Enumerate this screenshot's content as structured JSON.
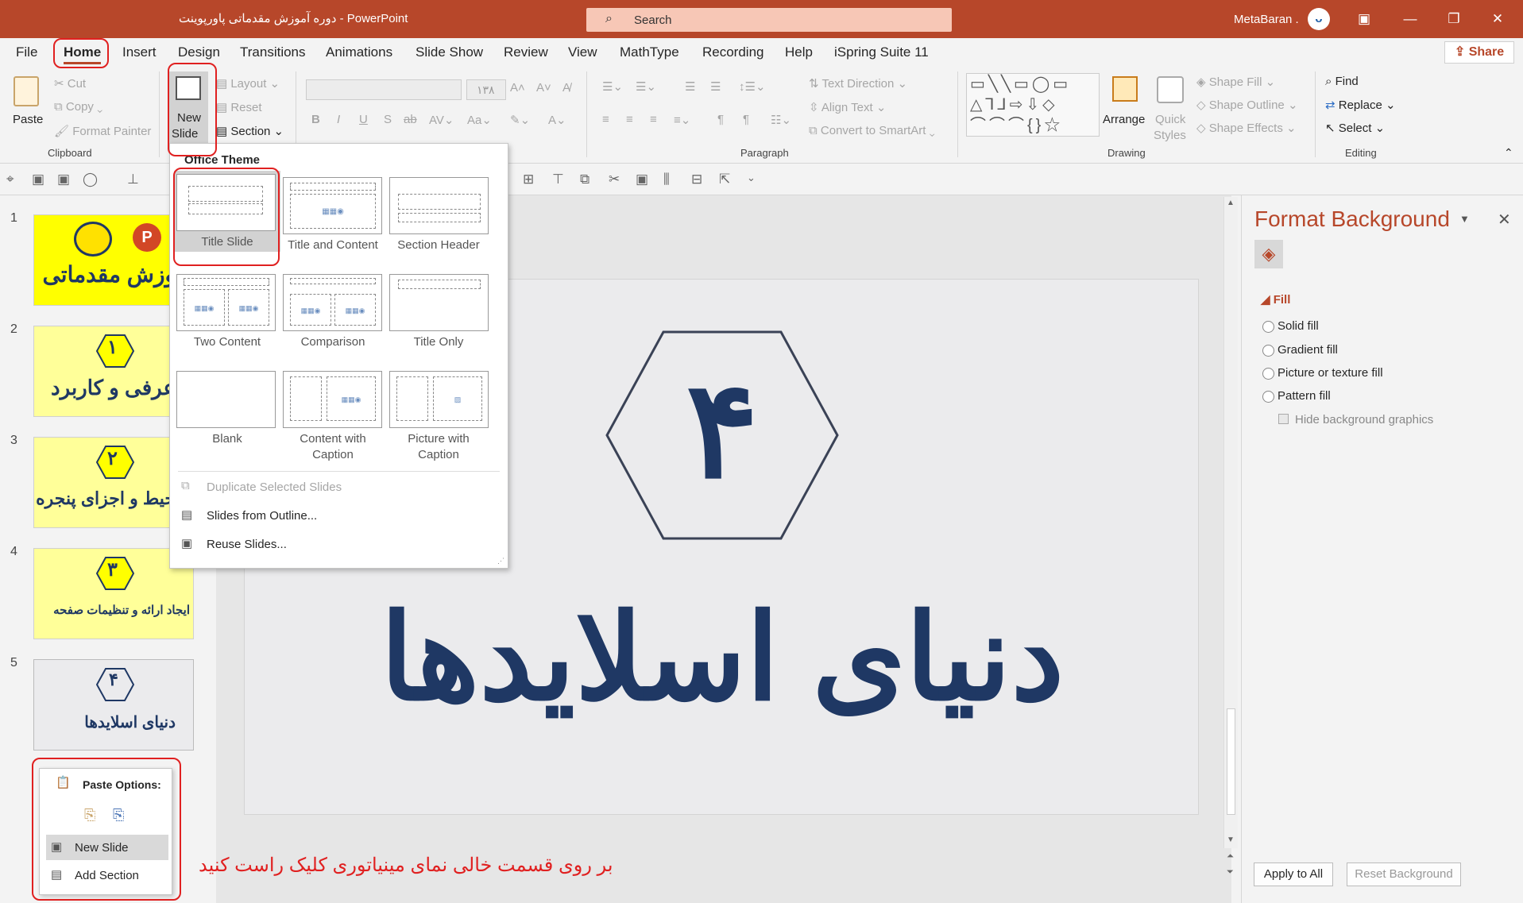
{
  "titlebar": {
    "doc_title": "دوره آموزش مقدماتی پاورپوینت  -  PowerPoint",
    "search_placeholder": "Search",
    "user": "MetaBaran .",
    "accent": "#b7472a"
  },
  "tabs": [
    "File",
    "Home",
    "Insert",
    "Design",
    "Transitions",
    "Animations",
    "Slide Show",
    "Review",
    "View",
    "MathType",
    "Recording",
    "Help",
    "iSpring Suite 11"
  ],
  "share": "Share",
  "ribbon": {
    "clipboard": {
      "paste": "Paste",
      "cut": "Cut",
      "copy": "Copy",
      "format_painter": "Format Painter",
      "group": "Clipboard"
    },
    "slides": {
      "new_slide_line1": "New",
      "new_slide_line2": "Slide",
      "layout": "Layout",
      "reset": "Reset",
      "section": "Section"
    },
    "font": {
      "size": "۱۳۸",
      "bold": "B",
      "italic": "I",
      "underline": "U",
      "shadow": "S",
      "strike": "ab"
    },
    "paragraph": {
      "text_direction": "Text Direction",
      "align_text": "Align Text",
      "convert_smartart": "Convert to SmartArt",
      "group": "Paragraph"
    },
    "drawing": {
      "arrange": "Arrange",
      "quick_styles_1": "Quick",
      "quick_styles_2": "Styles",
      "shape_fill": "Shape Fill",
      "shape_outline": "Shape Outline",
      "shape_effects": "Shape Effects",
      "group": "Drawing"
    },
    "editing": {
      "find": "Find",
      "replace": "Replace",
      "select": "Select",
      "group": "Editing"
    }
  },
  "dropdown": {
    "header": "Office Theme",
    "layouts": [
      {
        "label": "Title Slide"
      },
      {
        "label": "Title and Content"
      },
      {
        "label": "Section Header"
      },
      {
        "label": "Two Content"
      },
      {
        "label": "Comparison"
      },
      {
        "label": "Title Only"
      },
      {
        "label": "Blank"
      },
      {
        "label": "Content with\nCaption"
      },
      {
        "label": "Picture with\nCaption"
      }
    ],
    "duplicate": "Duplicate Selected Slides",
    "from_outline": "Slides from Outline...",
    "reuse": "Reuse Slides..."
  },
  "thumbnails": [
    {
      "num": "1",
      "text": "وزش مقدماتی"
    },
    {
      "num": "2",
      "badge": "۱",
      "text": "عرفی و کاربرد"
    },
    {
      "num": "3",
      "badge": "۲",
      "text": "حیط و اجزای پنجره"
    },
    {
      "num": "4",
      "badge": "۳",
      "text": "ایجاد ارائه و تنظیمات صفحه"
    },
    {
      "num": "5",
      "badge": "۴",
      "text": "دنیای اسلایدها"
    }
  ],
  "context_menu": {
    "paste_options": "Paste Options:",
    "new_slide": "New Slide",
    "add_section": "Add Section"
  },
  "slide": {
    "number": "۴",
    "title": "دنیای اسلایدها",
    "title_color": "#1f3864"
  },
  "format_pane": {
    "title": "Format Background",
    "fill": "Fill",
    "options": [
      "Solid fill",
      "Gradient fill",
      "Picture or texture fill",
      "Pattern fill"
    ],
    "hide_bg": "Hide background graphics",
    "apply_all": "Apply to All",
    "reset": "Reset Background"
  },
  "instruction": "بر روی قسمت خالی نمای مینیاتوری کلیک راست کنید"
}
